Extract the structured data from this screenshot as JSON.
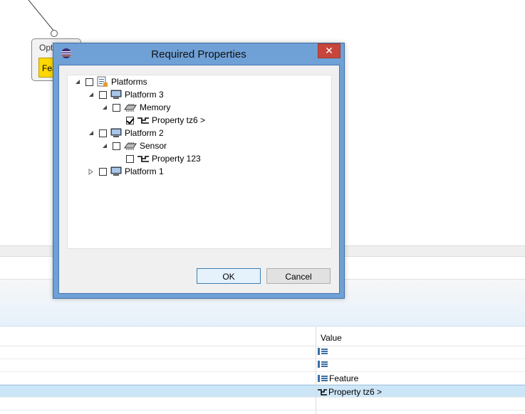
{
  "diagram": {
    "node_label": "Opt",
    "chip_label": "Fea"
  },
  "properties_table": {
    "column_value": "Value",
    "rows": [
      {
        "icon": "list-icon",
        "value": ""
      },
      {
        "icon": "list-icon",
        "value": ""
      },
      {
        "icon": "list-icon",
        "value": "Feature"
      },
      {
        "icon": "property-icon",
        "value": "Property tz6 >",
        "selected": true
      },
      {
        "icon": "",
        "value": ""
      }
    ]
  },
  "dialog": {
    "title": "Required Properties",
    "close_glyph": "✕",
    "ok_label": "OK",
    "cancel_label": "Cancel",
    "tree": [
      {
        "label": "Platforms",
        "expanded": true,
        "checked": false,
        "icon": "platforms-icon"
      },
      {
        "label": "Platform 3",
        "expanded": true,
        "checked": false,
        "icon": "computer-icon"
      },
      {
        "label": "Memory",
        "expanded": true,
        "checked": false,
        "icon": "chip-icon"
      },
      {
        "label": "Property tz6 >",
        "checked": true,
        "icon": "property-icon"
      },
      {
        "label": "Platform 2",
        "expanded": true,
        "checked": false,
        "icon": "computer-icon"
      },
      {
        "label": "Sensor",
        "expanded": true,
        "checked": false,
        "icon": "chip-icon"
      },
      {
        "label": "Property 123",
        "checked": false,
        "icon": "property-icon"
      },
      {
        "label": "Platform 1",
        "expanded": false,
        "checked": false,
        "icon": "computer-icon"
      }
    ]
  },
  "colors": {
    "dialog_frame": "#6fa0d6",
    "close_button": "#c7463b",
    "selected_row": "#cde6f7",
    "chip_yellow": "#ffd700"
  }
}
